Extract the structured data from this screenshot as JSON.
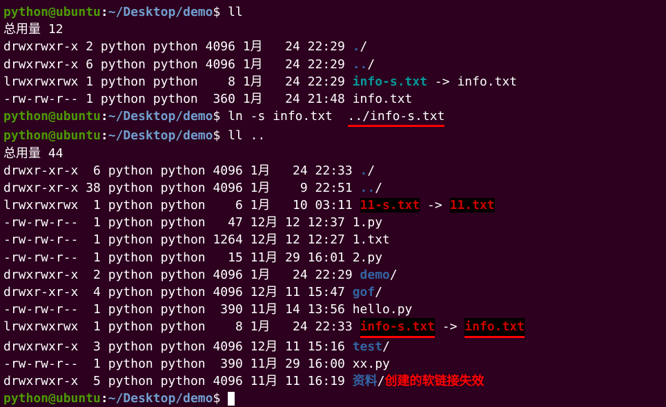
{
  "prompt": {
    "user": "python",
    "at": "@",
    "host": "ubuntu",
    "colon": ":",
    "path": "~/Desktop/demo",
    "dollar": "$"
  },
  "commands": {
    "c1": " ll",
    "c2": " ln -s info.txt  ",
    "c2_arg": "../info-s.txt",
    "c3": " ll ..",
    "c4": " "
  },
  "total1": "总用量 12",
  "total2": "总用量 44",
  "list1": {
    "r0": {
      "perm": "drwxrwxr-x",
      "nlink": " 2 ",
      "own": "python python",
      "size": " 4096 ",
      "date": "1月   24 22:29 ",
      "name": "."
    },
    "r1": {
      "perm": "drwxrwxr-x",
      "nlink": " 6 ",
      "own": "python python",
      "size": " 4096 ",
      "date": "1月   24 22:29 ",
      "name": ".."
    },
    "r2": {
      "perm": "lrwxrwxrwx",
      "nlink": " 1 ",
      "own": "python python",
      "size": "    8 ",
      "date": "1月   24 22:29 ",
      "name": "info-s.txt",
      "arrow": " -> ",
      "target": "info.txt"
    },
    "r3": {
      "perm": "-rw-rw-r--",
      "nlink": " 1 ",
      "own": "python python",
      "size": "  360 ",
      "date": "1月   24 21:48 ",
      "name": "info.txt"
    }
  },
  "list2": {
    "r0": {
      "perm": "drwxr-xr-x",
      "nlink": "  6 ",
      "own": "python python",
      "size": " 4096 ",
      "date": "1月   24 22:33 ",
      "name": "."
    },
    "r1": {
      "perm": "drwxr-xr-x",
      "nlink": " 38 ",
      "own": "python python",
      "size": " 4096 ",
      "date": "1月    9 22:51 ",
      "name": ".."
    },
    "r2": {
      "perm": "lrwxrwxrwx",
      "nlink": "  1 ",
      "own": "python python",
      "size": "    6 ",
      "date": "1月   10 03:11 ",
      "name": "11-s.txt",
      "arrow": " -> ",
      "target": "11.txt"
    },
    "r3": {
      "perm": "-rw-rw-r--",
      "nlink": "  1 ",
      "own": "python python",
      "size": "   47 ",
      "date": "12月 12 12:37 ",
      "name": "1.py"
    },
    "r4": {
      "perm": "-rw-rw-r--",
      "nlink": "  1 ",
      "own": "python python",
      "size": " 1264 ",
      "date": "12月 12 12:27 ",
      "name": "1.txt"
    },
    "r5": {
      "perm": "-rw-rw-r--",
      "nlink": "  1 ",
      "own": "python python",
      "size": "   15 ",
      "date": "11月 29 16:01 ",
      "name": "2.py"
    },
    "r6": {
      "perm": "drwxrwxr-x",
      "nlink": "  2 ",
      "own": "python python",
      "size": " 4096 ",
      "date": "1月   24 22:29 ",
      "name": "demo"
    },
    "r7": {
      "perm": "drwxr-xr-x",
      "nlink": "  4 ",
      "own": "python python",
      "size": " 4096 ",
      "date": "12月 11 15:47 ",
      "name": "gof"
    },
    "r8": {
      "perm": "-rw-rw-r--",
      "nlink": "  1 ",
      "own": "python python",
      "size": "  390 ",
      "date": "11月 14 13:56 ",
      "name": "hello.py"
    },
    "r9": {
      "perm": "lrwxrwxrwx",
      "nlink": "  1 ",
      "own": "python python",
      "size": "    8 ",
      "date": "1月   24 22:33 ",
      "name": "info-s.txt",
      "arrow": " -> ",
      "target": "info.txt"
    },
    "r10": {
      "perm": "drwxrwxr-x",
      "nlink": "  3 ",
      "own": "python python",
      "size": " 4096 ",
      "date": "12月 11 15:16 ",
      "name": "test"
    },
    "r11": {
      "perm": "-rw-rw-r--",
      "nlink": "  1 ",
      "own": "python python",
      "size": "  390 ",
      "date": "11月 29 16:00 ",
      "name": "xx.py"
    },
    "r12": {
      "perm": "drwxrwxr-x",
      "nlink": "  5 ",
      "own": "python python",
      "size": " 4096 ",
      "date": "11月 11 16:19 ",
      "name": "资料"
    }
  },
  "slash": "/",
  "annotation": "创建的软链接失效"
}
